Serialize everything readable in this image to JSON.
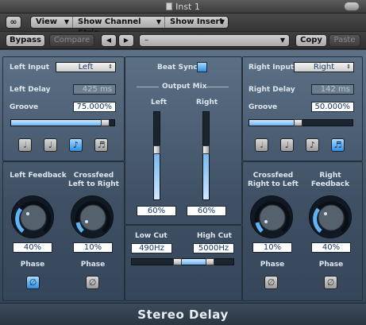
{
  "window": {
    "title": "Inst 1"
  },
  "toolbar": {
    "view_label": "View",
    "channel_strip_label": "Show Channel Strip",
    "insert_label": "Show Insert",
    "bypass_label": "Bypass",
    "compare_label": "Compare",
    "prev_label": "◀",
    "next_label": "▶",
    "preset_value": "–",
    "copy_label": "Copy",
    "paste_label": "Paste"
  },
  "left": {
    "input_label": "Left Input",
    "input_value": "Left",
    "delay_label": "Left Delay",
    "delay_value": "425 ms",
    "groove_label": "Groove",
    "groove_value": "75.000%",
    "groove_fraction": 0.95,
    "notes": [
      {
        "name": "half-note-icon",
        "glyph": "𝅗𝅥",
        "active": false
      },
      {
        "name": "quarter-note-icon",
        "glyph": "♩",
        "active": false
      },
      {
        "name": "eighth-note-icon",
        "glyph": "♪",
        "active": true
      },
      {
        "name": "sixteenth-note-icon",
        "glyph": "♬",
        "active": false
      }
    ],
    "feedback_label": "Left Feedback",
    "feedback_value": "40%",
    "crossfeed_label": "Crossfeed Left to Right",
    "crossfeed_value": "10%",
    "phase_label": "Phase",
    "phase_glyph": "∅"
  },
  "right": {
    "input_label": "Right Input",
    "input_value": "Right",
    "delay_label": "Right Delay",
    "delay_value": "142 ms",
    "groove_label": "Groove",
    "groove_value": "50.000%",
    "groove_fraction": 0.47,
    "notes": [
      {
        "name": "half-note-icon",
        "glyph": "𝅗𝅥",
        "active": false
      },
      {
        "name": "quarter-note-icon",
        "glyph": "♩",
        "active": false
      },
      {
        "name": "eighth-note-icon",
        "glyph": "♪",
        "active": false
      },
      {
        "name": "sixteenth-note-icon",
        "glyph": "♬",
        "active": true
      }
    ],
    "crossfeed_label": "Crossfeed Right to Left",
    "crossfeed_value": "10%",
    "feedback_label": "Right Feedback",
    "feedback_value": "40%",
    "phase_label": "Phase",
    "phase_glyph": "∅"
  },
  "center": {
    "beat_sync_label": "Beat Sync",
    "output_mix_label": "Output Mix",
    "left_label": "Left",
    "right_label": "Right",
    "left_mix_value": "60%",
    "right_mix_value": "60%",
    "low_cut_label": "Low Cut",
    "high_cut_label": "High Cut",
    "low_cut_value": "490Hz",
    "high_cut_value": "5000Hz"
  },
  "footer": {
    "plugin_name": "Stereo Delay"
  },
  "colors": {
    "accent": "#3d9bef",
    "panel": "#4b5d71",
    "text": "#dfe6ee"
  }
}
